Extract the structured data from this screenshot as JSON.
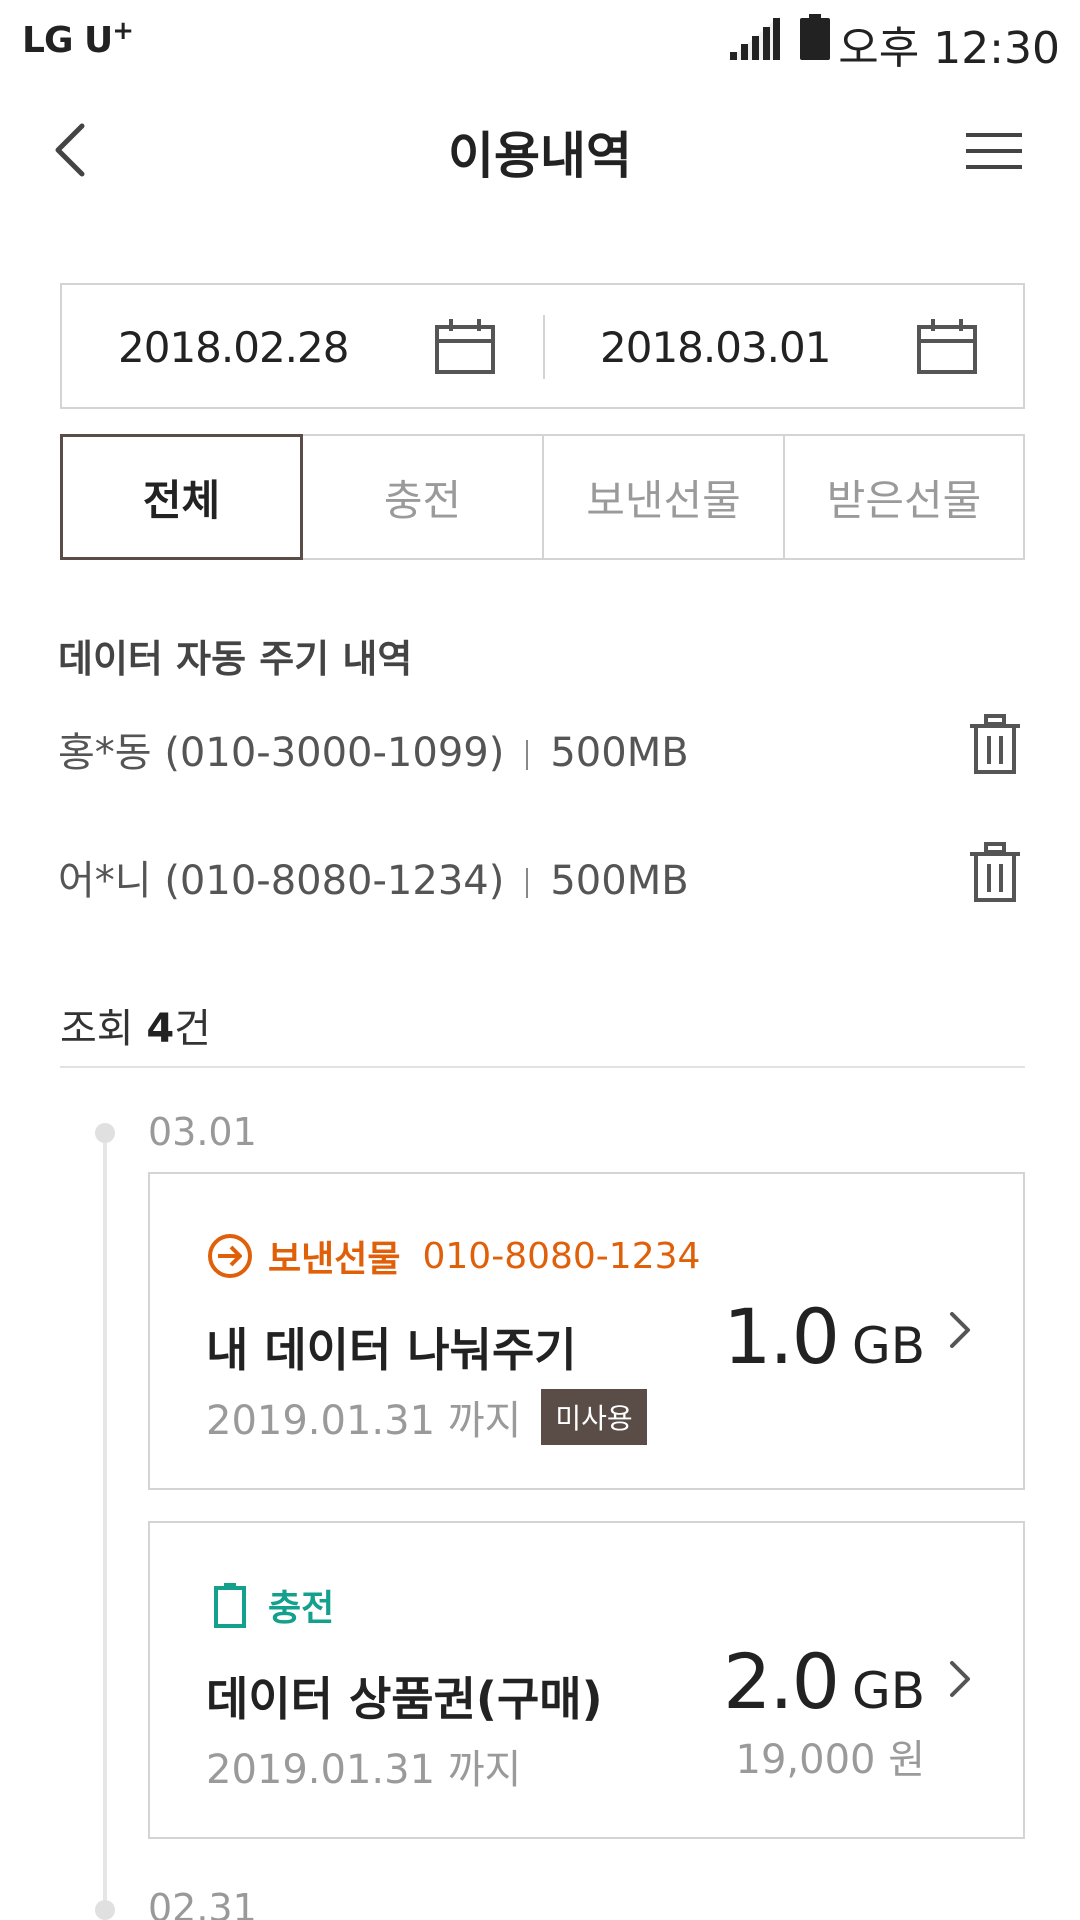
{
  "status_bar": {
    "carrier": "LG U",
    "carrier_sup": "+",
    "time": "오후 12:30"
  },
  "header": {
    "title": "이용내역",
    "back_icon": "chevron-left-icon",
    "menu_icon": "hamburger-menu-icon"
  },
  "date_range": {
    "start": "2018.02.28",
    "end": "2018.03.01",
    "icon": "calendar-icon"
  },
  "tabs": [
    {
      "label": "전체",
      "active": true
    },
    {
      "label": "충전",
      "active": false
    },
    {
      "label": "보낸선물",
      "active": false
    },
    {
      "label": "받은선물",
      "active": false
    }
  ],
  "auto_give": {
    "title": "데이터 자동 주기 내역",
    "items": [
      {
        "name": "홍*동 (010-3000-1099)",
        "amount": "500MB"
      },
      {
        "name": "어*니 (010-8080-1234)",
        "amount": "500MB"
      }
    ],
    "delete_icon": "trash-icon"
  },
  "count": {
    "prefix": "조회 ",
    "number": "4",
    "suffix": "건"
  },
  "timeline": [
    {
      "date": "03.01",
      "cards": [
        {
          "type": "보낸선물",
          "type_color": "#e0600a",
          "type_icon": "arrow-circle-right-icon",
          "phone": "010-8080-1234",
          "name": "내 데이터 나눠주기",
          "expiry": "2019.01.31 까지",
          "badge": "미사용",
          "amount": "1.0",
          "unit": "GB"
        },
        {
          "type": "충전",
          "type_color": "#13a08c",
          "type_icon": "battery-icon",
          "name": "데이터 상품권(구매)",
          "expiry": "2019.01.31 까지",
          "amount": "2.0",
          "unit": "GB",
          "price": "19,000 원"
        }
      ]
    },
    {
      "date": "02.31"
    }
  ]
}
